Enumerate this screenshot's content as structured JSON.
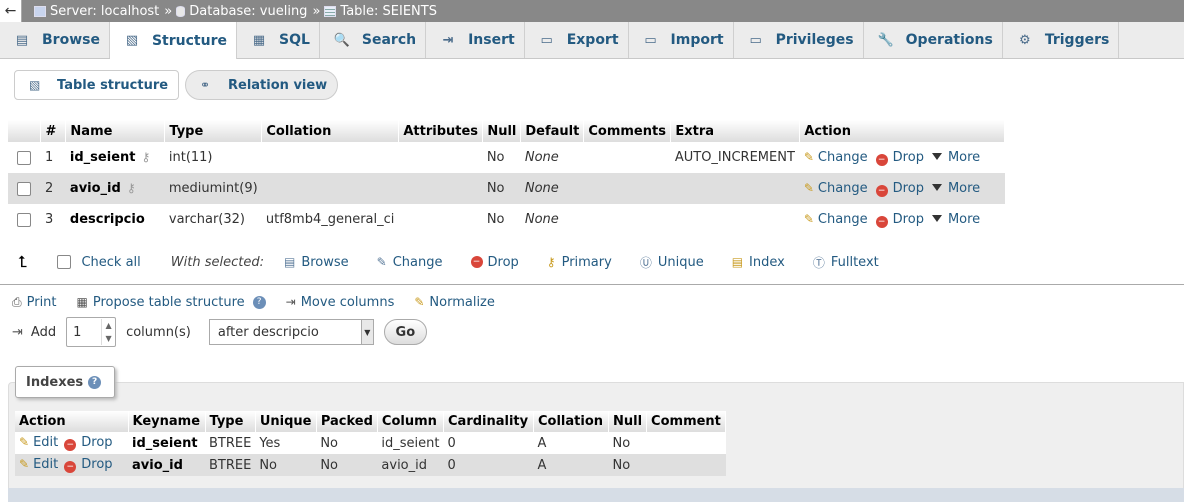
{
  "breadcrumb": {
    "back": "←",
    "server": "Server: localhost",
    "database": "Database: vueling",
    "table": "Table: SEIENTS",
    "separator": "»"
  },
  "tabs": [
    {
      "label": "Browse",
      "icon": "browse-icon",
      "glyph": "▤"
    },
    {
      "label": "Structure",
      "icon": "structure-icon",
      "glyph": "▧"
    },
    {
      "label": "SQL",
      "icon": "sql-icon",
      "glyph": "▦"
    },
    {
      "label": "Search",
      "icon": "search-icon",
      "glyph": "🔍"
    },
    {
      "label": "Insert",
      "icon": "insert-icon",
      "glyph": "⇥"
    },
    {
      "label": "Export",
      "icon": "export-icon",
      "glyph": "▭"
    },
    {
      "label": "Import",
      "icon": "import-icon",
      "glyph": "▭"
    },
    {
      "label": "Privileges",
      "icon": "privileges-icon",
      "glyph": "▭"
    },
    {
      "label": "Operations",
      "icon": "wrench-icon",
      "glyph": "🔧"
    },
    {
      "label": "Triggers",
      "icon": "triggers-icon",
      "glyph": "⚙"
    }
  ],
  "subtabs": {
    "table_structure": "Table structure",
    "relation_view": "Relation view"
  },
  "columns_table": {
    "headers": [
      "#",
      "Name",
      "Type",
      "Collation",
      "Attributes",
      "Null",
      "Default",
      "Comments",
      "Extra",
      "Action"
    ],
    "rows": [
      {
        "num": "1",
        "name": "id_seient",
        "type": "int(11)",
        "collation": "",
        "attributes": "",
        "null": "No",
        "default": "None",
        "comments": "",
        "extra": "AUTO_INCREMENT"
      },
      {
        "num": "2",
        "name": "avio_id",
        "type": "mediumint(9)",
        "collation": "",
        "attributes": "",
        "null": "No",
        "default": "None",
        "comments": "",
        "extra": ""
      },
      {
        "num": "3",
        "name": "descripcio",
        "type": "varchar(32)",
        "collation": "utf8mb4_general_ci",
        "attributes": "",
        "null": "No",
        "default": "None",
        "comments": "",
        "extra": ""
      }
    ],
    "action_change": "Change",
    "action_drop": "Drop",
    "action_more": "More"
  },
  "with_selected": {
    "check_all": "Check all",
    "label": "With selected:",
    "browse": "Browse",
    "change": "Change",
    "drop": "Drop",
    "primary": "Primary",
    "unique": "Unique",
    "index": "Index",
    "fulltext": "Fulltext"
  },
  "links": {
    "print": "Print",
    "propose": "Propose table structure",
    "move_columns": "Move columns",
    "normalize": "Normalize"
  },
  "add_columns": {
    "add": "Add",
    "count": "1",
    "columns_label": "column(s)",
    "position": "after descripcio",
    "go": "Go"
  },
  "indexes": {
    "title": "Indexes",
    "headers": [
      "Action",
      "Keyname",
      "Type",
      "Unique",
      "Packed",
      "Column",
      "Cardinality",
      "Collation",
      "Null",
      "Comment"
    ],
    "edit": "Edit",
    "drop": "Drop",
    "rows": [
      {
        "keyname": "id_seient",
        "type": "BTREE",
        "unique": "Yes",
        "packed": "No",
        "column": "id_seient",
        "cardinality": "0",
        "collation": "A",
        "null": "No",
        "comment": ""
      },
      {
        "keyname": "avio_id",
        "type": "BTREE",
        "unique": "No",
        "packed": "No",
        "column": "avio_id",
        "cardinality": "0",
        "collation": "A",
        "null": "No",
        "comment": ""
      }
    ]
  },
  "colors": {
    "link": "#235a81",
    "drop_icon": "#d9463a",
    "row_alt": "#dfdfdf",
    "breadcrumb_bg": "#888888"
  }
}
